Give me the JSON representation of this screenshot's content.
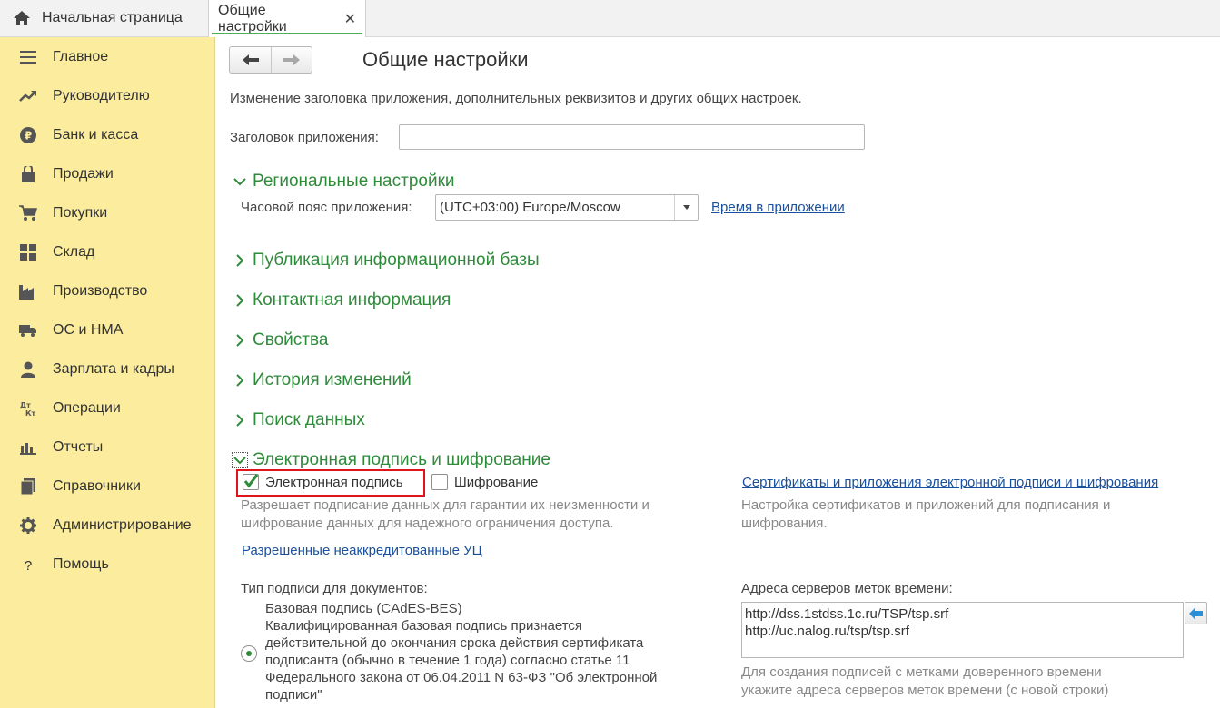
{
  "tabs": {
    "home_label": "Начальная страница",
    "active_label": "Общие настройки",
    "close_glyph": "✕"
  },
  "sidebar": {
    "items": [
      {
        "label": "Главное",
        "icon": "menu-icon"
      },
      {
        "label": "Руководителю",
        "icon": "trend-icon"
      },
      {
        "label": "Банк и касса",
        "icon": "ruble-icon"
      },
      {
        "label": "Продажи",
        "icon": "bag-icon"
      },
      {
        "label": "Покупки",
        "icon": "cart-icon"
      },
      {
        "label": "Склад",
        "icon": "grid-icon"
      },
      {
        "label": "Производство",
        "icon": "factory-icon"
      },
      {
        "label": "ОС и НМА",
        "icon": "truck-icon"
      },
      {
        "label": "Зарплата и кадры",
        "icon": "person-icon"
      },
      {
        "label": "Операции",
        "icon": "dt-kt-icon"
      },
      {
        "label": "Отчеты",
        "icon": "bar-chart-icon"
      },
      {
        "label": "Справочники",
        "icon": "books-icon"
      },
      {
        "label": "Администрирование",
        "icon": "gear-icon"
      },
      {
        "label": "Помощь",
        "icon": "question-icon"
      }
    ],
    "bg_color": "#fbec9e"
  },
  "page": {
    "title": "Общие настройки",
    "description": "Изменение заголовка приложения, дополнительных реквизитов и других общих настроек.",
    "app_title_label": "Заголовок приложения:",
    "app_title_value": ""
  },
  "regional": {
    "title": "Региональные настройки",
    "timezone_label": "Часовой пояс приложения:",
    "timezone_value": "(UTC+03:00) Europe/Moscow",
    "time_link": "Время в приложении"
  },
  "sections": {
    "publication": "Публикация информационной базы",
    "contacts": "Контактная информация",
    "properties": "Свойства",
    "history": "История изменений",
    "search": "Поиск данных",
    "signature": "Электронная подпись и шифрование"
  },
  "signature": {
    "es_label": "Электронная подпись",
    "es_checked": true,
    "enc_label": "Шифрование",
    "enc_checked": false,
    "hint_line1": "Разрешает подписание данных для гарантии их неизменности и",
    "hint_line2": "шифрование данных для надежного ограничения доступа.",
    "uc_link": "Разрешенные неаккредитованные УЦ",
    "certs_link": "Сертификаты и приложения электронной подписи и шифрования",
    "certs_hint_line1": "Настройка сертификатов и приложений для подписания и",
    "certs_hint_line2": "шифрования.",
    "sig_type_label": "Тип подписи для документов:",
    "radio_lines": [
      "Базовая подпись (CAdES-BES)",
      "Квалифицированная базовая подпись признается",
      "действительной до окончания срока действия сертификата",
      "подписанта (обычно в течение 1 года) согласно статье 11",
      "Федерального закона от 06.04.2011 N 63-ФЗ \"Об электронной",
      "подписи\""
    ],
    "ts_label": "Адреса серверов меток времени:",
    "ts_lines": [
      "http://dss.1stdss.1c.ru/TSP/tsp.srf",
      "http://uc.nalog.ru/tsp/tsp.srf"
    ],
    "ts_hint_line1": "Для создания подписей с метками доверенного времени",
    "ts_hint_line2": "укажите адреса серверов меток времени (с новой строки)"
  },
  "colors": {
    "accent_green": "#2e8b3a",
    "link_blue": "#1a4f9c",
    "highlight_red": "#e0141e"
  }
}
